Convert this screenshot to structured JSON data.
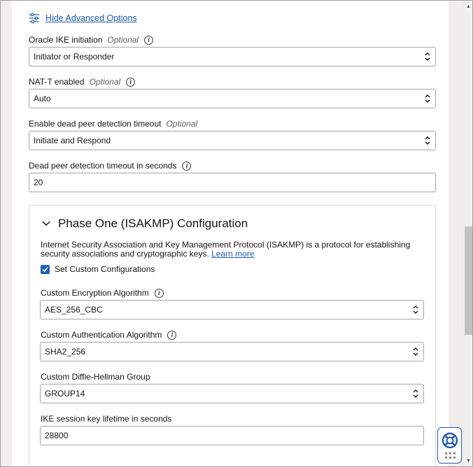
{
  "advanced": {
    "toggle_label": "Hide Advanced Options"
  },
  "fields": {
    "ike_initiation": {
      "label": "Oracle IKE initiation",
      "optional": "Optional",
      "value": "Initiator or Responder"
    },
    "nat_t": {
      "label": "NAT-T enabled",
      "optional": "Optional",
      "value": "Auto"
    },
    "dpd": {
      "label": "Enable dead peer detection timeout",
      "optional": "Optional",
      "value": "Initiate and Respond"
    },
    "dpd_timeout": {
      "label": "Dead peer detection timeout in seconds",
      "value": "20"
    }
  },
  "phase_one": {
    "title": "Phase One (ISAKMP) Configuration",
    "description": "Internet Security Association and Key Management Protocol (ISAKMP) is a protocol for establishing security associations and cryptographic keys.",
    "learn_more": "Learn more",
    "custom_config_label": "Set Custom Configurations",
    "custom_config_checked": true,
    "encryption": {
      "label": "Custom Encryption Algorithm",
      "value": "AES_256_CBC"
    },
    "authentication": {
      "label": "Custom Authentication Algorithm",
      "value": "SHA2_256"
    },
    "dh_group": {
      "label": "Custom Diffie-Hellman Group",
      "value": "GROUP14"
    },
    "lifetime": {
      "label": "IKE session key lifetime in seconds",
      "value": "28800"
    }
  },
  "icons": {
    "advanced": "sliders-icon",
    "info": "info-icon",
    "select": "chevron-up-down-icon",
    "collapse": "chevron-down-icon",
    "check": "checkmark-icon",
    "help": "lifebuoy-icon"
  },
  "colors": {
    "link": "#1f5bae",
    "checkbox": "#1a5ec0",
    "help_border": "#1f5bae"
  }
}
